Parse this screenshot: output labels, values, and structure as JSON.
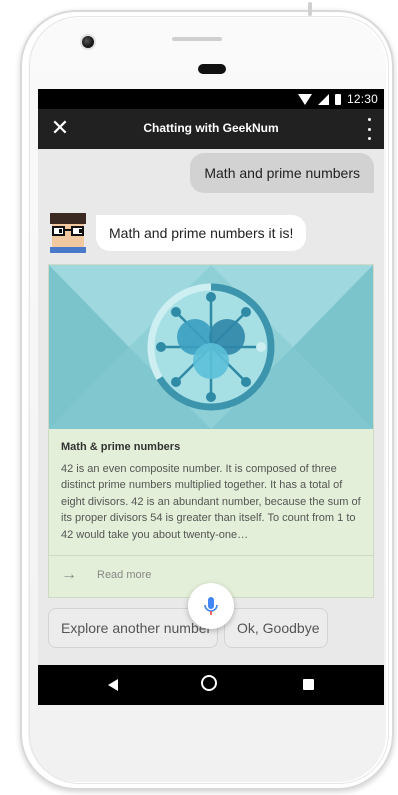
{
  "status_bar": {
    "time": "12:30"
  },
  "app_bar": {
    "title": "Chatting with GeekNum",
    "close_glyph": "✕",
    "close_icon": "close-icon",
    "more_icon": "more-vert-icon"
  },
  "messages": {
    "user": "Math and prime numbers",
    "bot": "Math and prime numbers it is!"
  },
  "card": {
    "title": "Math & prime numbers",
    "text": "42 is an even composite number. It is composed of three distinct prime numbers multiplied together. It has a total of eight divisors. 42 is an abundant number, because the sum of its proper divisors 54 is greater than itself. To count from 1 to 42 would take you about twenty-one…",
    "link_label": "Read more",
    "link_glyph": "→"
  },
  "suggestions": [
    "Explore another number",
    "Ok, Goodbye"
  ],
  "colors": {
    "app_bar": "#212121",
    "card_background": "#e3efd8",
    "card_image_background": "#8fd0d7",
    "mic_accent": "#4285f4"
  }
}
